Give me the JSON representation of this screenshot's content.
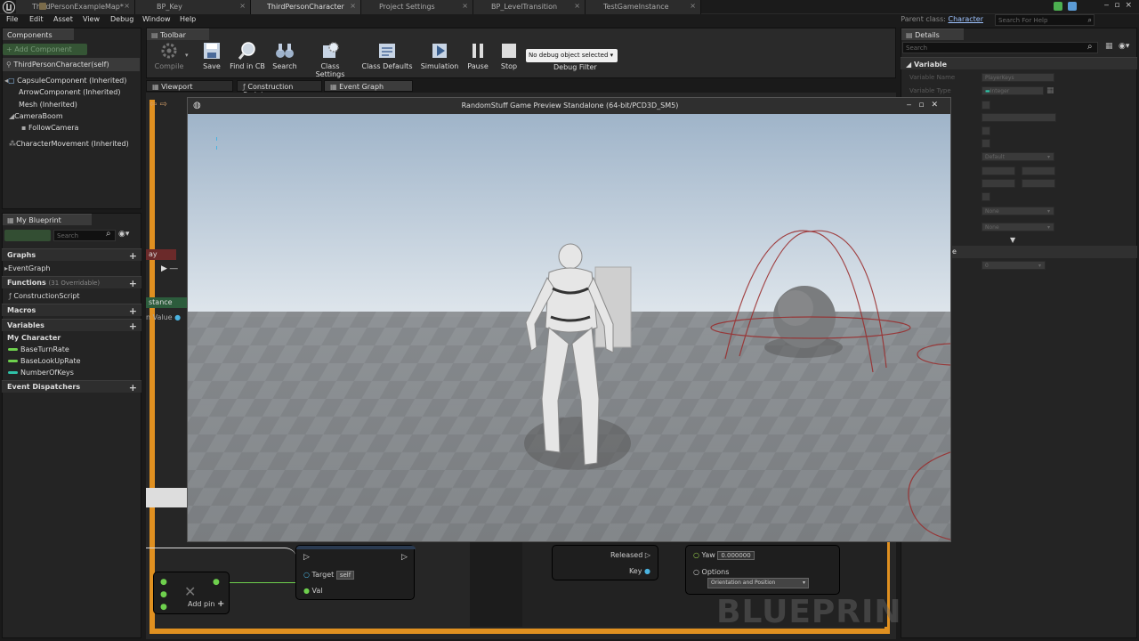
{
  "tabs": [
    {
      "label": "ThirdPersonExampleMap*",
      "active": false
    },
    {
      "label": "BP_Key",
      "active": false
    },
    {
      "label": "ThirdPersonCharacter",
      "active": true
    },
    {
      "label": "Project Settings",
      "active": false
    },
    {
      "label": "BP_LevelTransition",
      "active": false
    },
    {
      "label": "TestGameInstance",
      "active": false
    }
  ],
  "parent_class_label": "Parent class:",
  "parent_class_value": "Character",
  "search_help_placeholder": "Search For Help",
  "menu": [
    "File",
    "Edit",
    "Asset",
    "View",
    "Debug",
    "Window",
    "Help"
  ],
  "components": {
    "title": "Components",
    "add_button": "+ Add Component",
    "root": "ThirdPersonCharacter(self)",
    "items": [
      "CapsuleComponent (Inherited)",
      "ArrowComponent (Inherited)",
      "Mesh (Inherited)",
      "CameraBoom",
      "FollowCamera",
      "CharacterMovement (Inherited)"
    ]
  },
  "my_blueprint": {
    "title": "My Blueprint",
    "search_placeholder": "Search",
    "sections": {
      "graphs": "Graphs",
      "graph_item": "EventGraph",
      "functions": "Functions",
      "functions_note": "(31 Overridable)",
      "function_item": "ConstructionScript",
      "macros": "Macros",
      "variables": "Variables",
      "category": "My Character",
      "vars": [
        "BaseTurnRate",
        "BaseLookUpRate",
        "NumberOfKeys"
      ],
      "dispatchers": "Event Dispatchers"
    }
  },
  "toolbar": {
    "title": "Toolbar",
    "buttons": [
      "Compile",
      "Save",
      "Find in CB",
      "Search",
      "Class Settings",
      "Class Defaults",
      "Simulation",
      "Pause",
      "Stop"
    ],
    "debug_select": "No debug object selected",
    "debug_filter": "Debug Filter"
  },
  "graph_tabs": [
    "Viewport",
    "Construction Script",
    "Event Graph"
  ],
  "graph_nodes": {
    "play_label": "ay",
    "instance_label": "stance",
    "value_label": "n Value",
    "target_label": "Target",
    "self_label": "self",
    "val_label": "Val",
    "add_pin": "Add pin",
    "released": "Released",
    "key": "Key",
    "yaw_label": "Yaw",
    "yaw_value": "0.000000",
    "options_label": "Options",
    "options_value": "Orientation and Position"
  },
  "watermark": "BLUEPRINT",
  "details": {
    "title": "Details",
    "search_placeholder": "Search",
    "section": "Variable",
    "labels": [
      "Variable Name",
      "Variable Type"
    ],
    "var_name": "PlayerKeys",
    "var_type": "Integer",
    "default_dropdown": "Default",
    "none1": "None",
    "none2": "None",
    "default_value": "0"
  },
  "preview": {
    "title": "RandomStuff Game Preview Standalone (64-bit/PCD3D_SM5)"
  }
}
